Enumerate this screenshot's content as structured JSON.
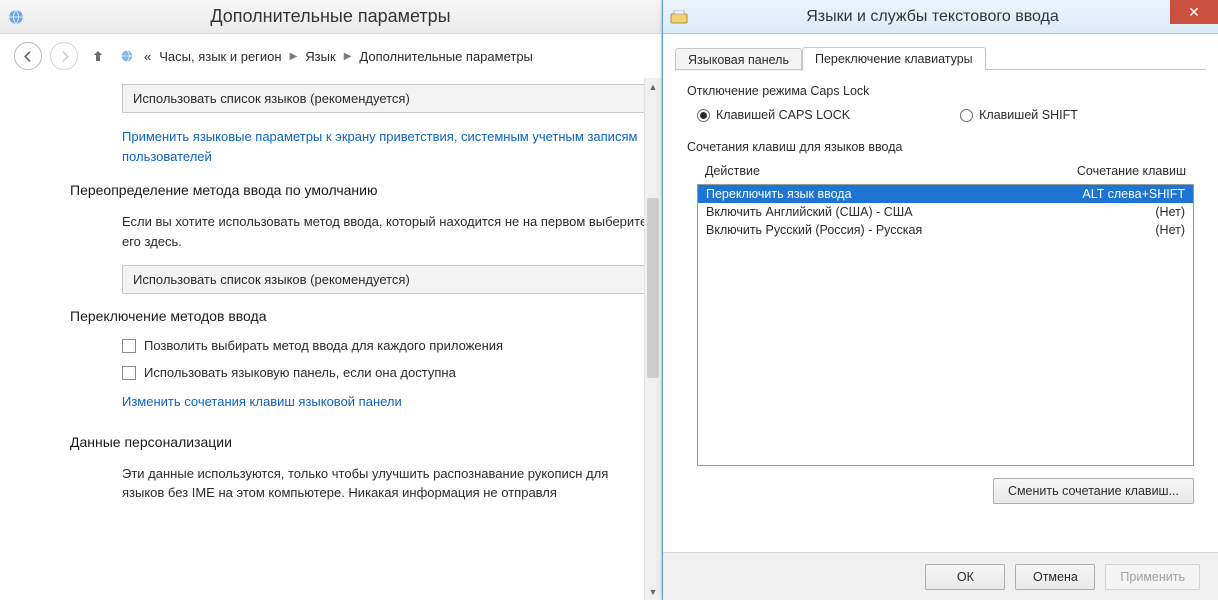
{
  "left": {
    "title": "Дополнительные параметры",
    "breadcrumb": {
      "back": "«",
      "items": [
        "Часы, язык и регион",
        "Язык",
        "Дополнительные параметры"
      ]
    },
    "lang_list_dropdown": "Использовать список языков (рекомендуется)",
    "link_apply_welcome": "Применить языковые параметры к экрану приветствия, системным учетным записям пользователей",
    "override_heading": "Переопределение метода ввода по умолчанию",
    "override_text": "Если вы хотите использовать метод ввода, который находится не на первом выберите его здесь.",
    "method_list_dropdown": "Использовать список языков (рекомендуется)",
    "switch_heading": "Переключение методов ввода",
    "chk_per_app": "Позволить выбирать метод ввода для каждого приложения",
    "chk_use_panel": "Использовать языковую панель, если она доступна",
    "link_change_hotkeys": "Изменить сочетания клавиш языковой панели",
    "personal_heading": "Данные персонализации",
    "personal_text": "Эти данные используются, только чтобы улучшить распознавание рукописн для языков без IME на этом компьютере. Никакая информация не отправля"
  },
  "right": {
    "title": "Языки и службы текстового ввода",
    "tabs": {
      "panel": "Языковая панель",
      "switch": "Переключение клавиатуры"
    },
    "caps_group": "Отключение режима Caps Lock",
    "radio_caps": "Клавишей CAPS LOCK",
    "radio_shift": "Клавишей SHIFT",
    "hotkeys_group": "Сочетания клавиш для языков ввода",
    "col_action": "Действие",
    "col_combo": "Сочетание клавиш",
    "rows": [
      {
        "action": "Переключить язык ввода",
        "combo": "ALT слева+SHIFT"
      },
      {
        "action": "Включить Английский (США) - США",
        "combo": "(Нет)"
      },
      {
        "action": "Включить Русский (Россия) - Русская",
        "combo": "(Нет)"
      }
    ],
    "change_btn": "Сменить сочетание клавиш...",
    "ok": "ОК",
    "cancel": "Отмена",
    "apply": "Применить"
  }
}
